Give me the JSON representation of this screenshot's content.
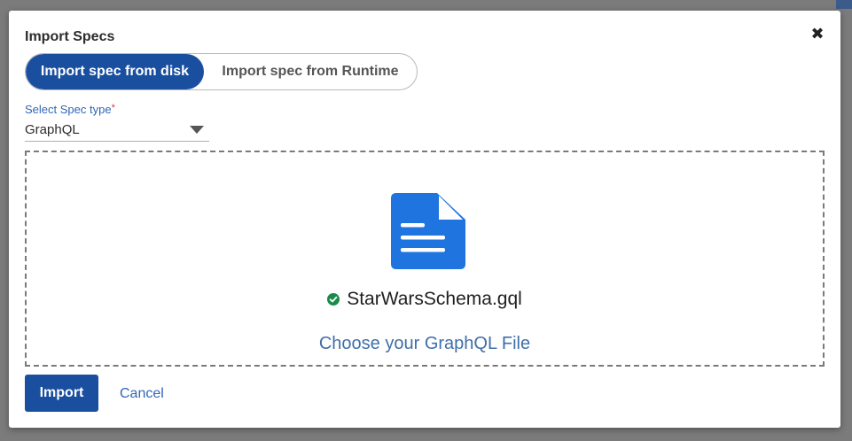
{
  "dialog": {
    "title": "Import Specs",
    "close_glyph": "✖"
  },
  "toggle": {
    "options": [
      {
        "label": "Import spec from disk",
        "selected": true
      },
      {
        "label": "Import spec from Runtime",
        "selected": false
      }
    ]
  },
  "spec_type": {
    "label": "Select Spec type",
    "required_mark": "*",
    "selected": "GraphQL"
  },
  "dropzone": {
    "file_icon": "document-icon",
    "status_icon": "check-circle-icon",
    "file_name": "StarWarsSchema.gql",
    "choose_label": "Choose your GraphQL File"
  },
  "actions": {
    "import_label": "Import",
    "cancel_label": "Cancel"
  },
  "colors": {
    "primary": "#1a4fa0",
    "link": "#2e67b8",
    "file_icon": "#1f74e0",
    "success": "#1a8a4a"
  }
}
